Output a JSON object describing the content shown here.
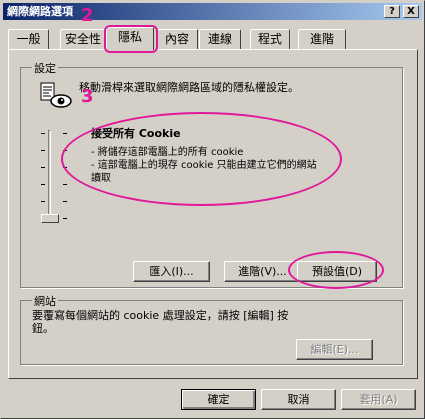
{
  "window": {
    "title": "網際網路選項",
    "help_btn": "?",
    "close_btn": "X"
  },
  "tabs": [
    {
      "label": "一般"
    },
    {
      "label": "安全性"
    },
    {
      "label": "隱私"
    },
    {
      "label": "內容"
    },
    {
      "label": "連線"
    },
    {
      "label": "程式"
    },
    {
      "label": "進階"
    }
  ],
  "settings": {
    "group_label": "設定",
    "description": "移動滑桿來選取網際網路區域的隱私權設定。",
    "level_title": "接受所有 Cookie",
    "level_items": [
      "- 將儲存這部電腦上的所有 cookie",
      "- 這部電腦上的現存 cookie 只能由建立它們的網站讀取"
    ],
    "slider_level": 0,
    "buttons": {
      "import": "匯入(I)...",
      "advanced": "進階(V)...",
      "default": "預設值(D)"
    }
  },
  "websites": {
    "group_label": "網站",
    "description": "要覆寫每個網站的 cookie 處理設定，請按 [編輯] 按鈕。",
    "edit_button": "編輯(E)..."
  },
  "footer": {
    "ok": "確定",
    "cancel": "取消",
    "apply": "套用(A)"
  },
  "annotations": {
    "tab_marker": "2",
    "icon_marker": "3"
  },
  "colors": {
    "annotation": "#e0189a",
    "titlebar_start": "#0a246a",
    "titlebar_end": "#a6caf0"
  }
}
